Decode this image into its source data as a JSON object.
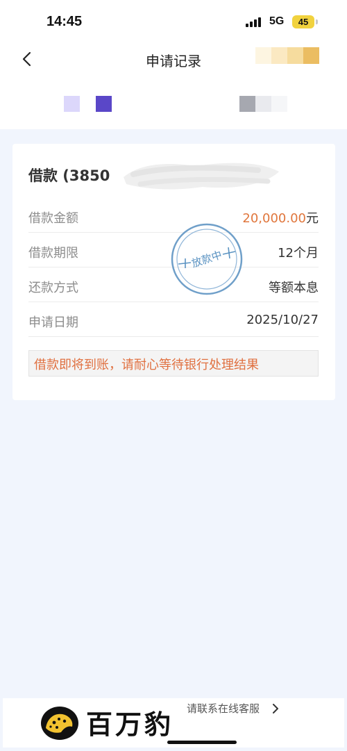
{
  "status_bar": {
    "time": "14:45",
    "network": "5G",
    "battery": "45"
  },
  "nav": {
    "title": "申请记录",
    "back_icon": "chevron-left-icon"
  },
  "colors": {
    "accent_orange": "#e0763c",
    "stamp_blue": "#5b93c2",
    "background": "#f1f5fd"
  },
  "record": {
    "title": "借款 (3850",
    "rows": [
      {
        "label": "借款金额",
        "value": "20,000.00",
        "unit": "元"
      },
      {
        "label": "借款期限",
        "value": "12个月"
      },
      {
        "label": "还款方式",
        "value": "等额本息"
      },
      {
        "label": "申请日期",
        "value": "2025/10/27"
      }
    ],
    "stamp_text": "放款中",
    "notice": "借款即将到账，请耐心等待银行处理结果"
  },
  "footer": {
    "contact": "请联系在线客服",
    "logo_text": "百万豹",
    "logo_icon": "leopard-logo-icon"
  }
}
